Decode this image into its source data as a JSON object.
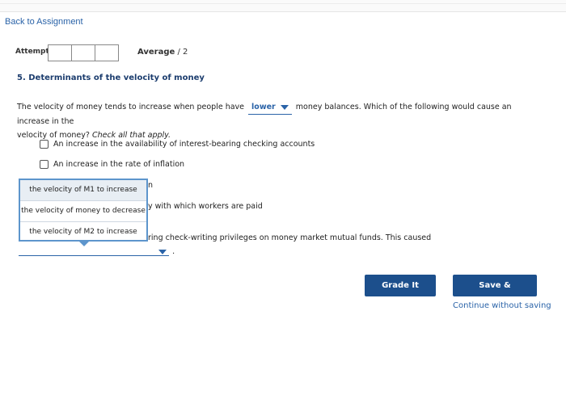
{
  "nav": {
    "back_label": "Back to Assignment"
  },
  "attempts": {
    "label": "Attempts",
    "boxes": 3
  },
  "average": {
    "label": "Average",
    "value": "/ 2"
  },
  "question": {
    "title": "5. Determinants of the velocity of money",
    "text_before": "The velocity of money tends to increase when people have",
    "inline_select_value": "lower",
    "text_after": "money balances. Which of the following would cause an increase in the",
    "text_line2_a": "velocity of money?",
    "text_line2_b": "Check all that apply."
  },
  "options": [
    {
      "label": "An increase in the availability of interest-bearing checking accounts"
    },
    {
      "label": "An increase in the rate of inflation"
    }
  ],
  "partials": {
    "p1": "n",
    "p2": "y with which workers are paid",
    "p3": "ring check-writing privileges on money market mutual funds. This caused",
    "p4": "."
  },
  "dropdown": {
    "items": [
      "the velocity of M1 to increase",
      "the velocity of money to decrease",
      "the velocity of M2 to increase"
    ]
  },
  "buttons": {
    "grade": "Grade It Now",
    "save": "Save & Continue",
    "continue": "Continue without saving"
  }
}
